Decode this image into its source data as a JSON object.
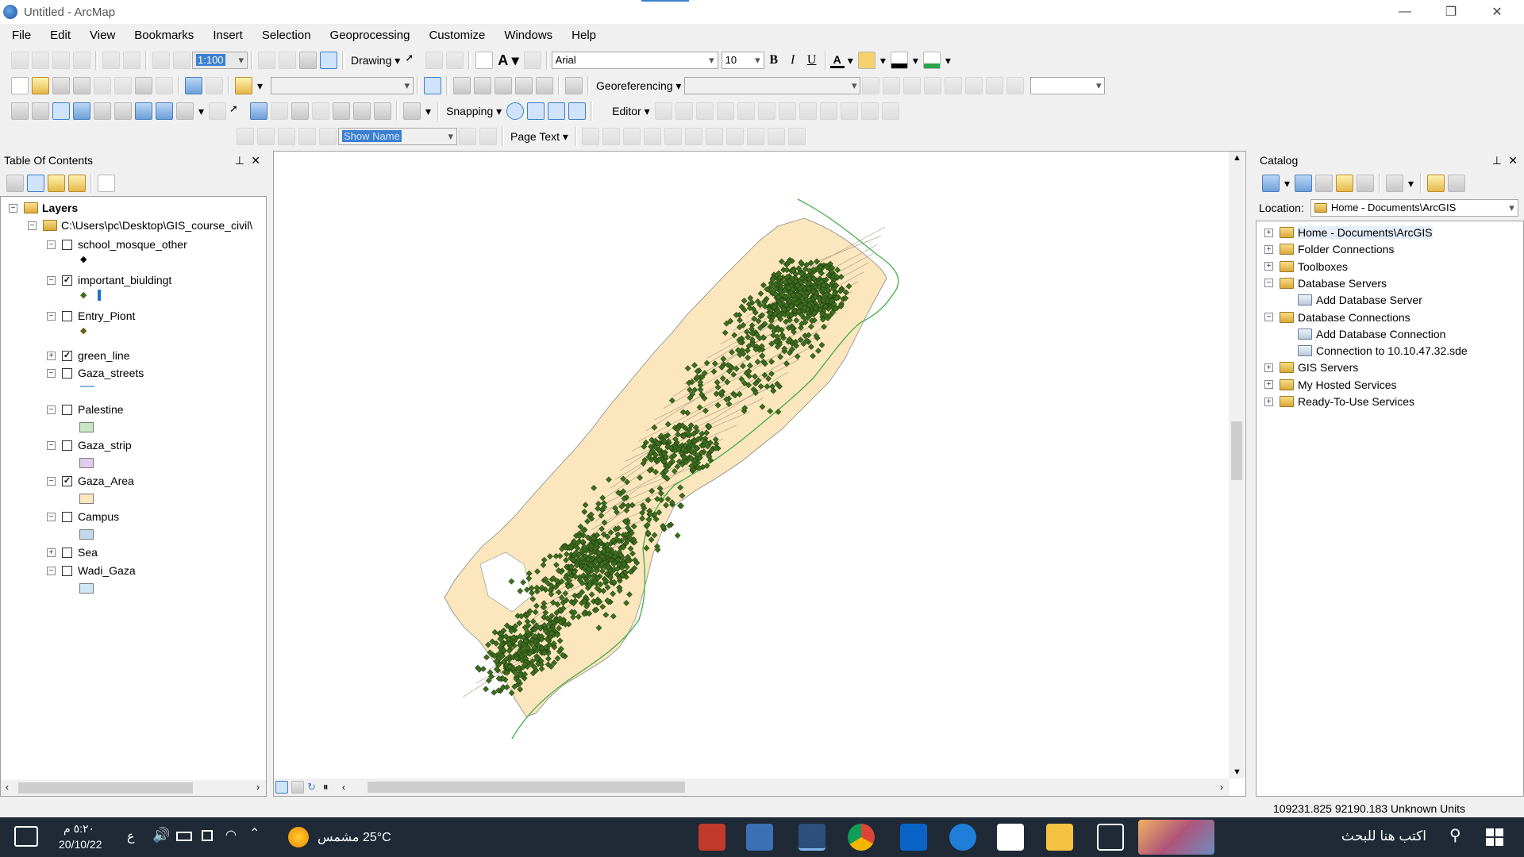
{
  "window": {
    "title": "Untitled - ArcMap"
  },
  "menu": [
    "File",
    "Edit",
    "View",
    "Bookmarks",
    "Insert",
    "Selection",
    "Geoprocessing",
    "Customize",
    "Windows",
    "Help"
  ],
  "toolbars": {
    "scale_value": "1:100",
    "drawing_label": "Drawing",
    "font_name": "Arial",
    "font_size": "10",
    "bold": "B",
    "italic": "I",
    "underline": "U",
    "georeferencing_label": "Georeferencing",
    "snapping_label": "Snapping",
    "editor_label": "Editor",
    "show_name_value": "Show Name",
    "page_text_label": "Page Text"
  },
  "toc": {
    "title": "Table Of Contents",
    "root": "Layers",
    "path": "C:\\Users\\pc\\Desktop\\GIS_course_civil\\",
    "layers": [
      {
        "name": "school_mosque_other",
        "checked": false,
        "expanded": true
      },
      {
        "name": "important_biuldingt",
        "checked": true,
        "expanded": true
      },
      {
        "name": "Entry_Piont",
        "checked": false,
        "expanded": true
      },
      {
        "name": "green_line",
        "checked": true,
        "expanded": false
      },
      {
        "name": "Gaza_streets",
        "checked": false,
        "expanded": true
      },
      {
        "name": "Palestine",
        "checked": false,
        "expanded": true,
        "color": "#c7e6c3"
      },
      {
        "name": "Gaza_strip",
        "checked": false,
        "expanded": true,
        "color": "#e2cdee"
      },
      {
        "name": "Gaza_Area",
        "checked": true,
        "expanded": true,
        "color": "#fbe6bd"
      },
      {
        "name": "Campus",
        "checked": false,
        "expanded": true,
        "color": "#c5d7ea"
      },
      {
        "name": "Sea",
        "checked": false,
        "expanded": false
      },
      {
        "name": "Wadi_Gaza",
        "checked": false,
        "expanded": true,
        "color": "#cfe6f6"
      }
    ]
  },
  "catalog": {
    "title": "Catalog",
    "location_label": "Location:",
    "location_value": "Home - Documents\\ArcGIS",
    "items": [
      {
        "label": "Home - Documents\\ArcGIS",
        "level": 0,
        "exp": "+"
      },
      {
        "label": "Folder Connections",
        "level": 0,
        "exp": "+"
      },
      {
        "label": "Toolboxes",
        "level": 0,
        "exp": "+"
      },
      {
        "label": "Database Servers",
        "level": 0,
        "exp": "−"
      },
      {
        "label": "Add Database Server",
        "level": 1,
        "exp": ""
      },
      {
        "label": "Database Connections",
        "level": 0,
        "exp": "−"
      },
      {
        "label": "Add Database Connection",
        "level": 1,
        "exp": ""
      },
      {
        "label": "Connection to 10.10.47.32.sde",
        "level": 1,
        "exp": ""
      },
      {
        "label": "GIS Servers",
        "level": 0,
        "exp": "+"
      },
      {
        "label": "My Hosted Services",
        "level": 0,
        "exp": "+"
      },
      {
        "label": "Ready-To-Use Services",
        "level": 0,
        "exp": "+"
      }
    ]
  },
  "status": {
    "coordinates": "109231.825  92190.183 Unknown Units"
  },
  "taskbar": {
    "search_placeholder": "اكتب هنا للبحث",
    "weather": "25°C  مشمس",
    "time": "٥:٢٠ م",
    "date": "20/10/22",
    "lang": "ع"
  },
  "colors": {
    "area_fill": "#fbe6bd",
    "point": "#3d6e1f",
    "green_line": "#3fae49"
  }
}
